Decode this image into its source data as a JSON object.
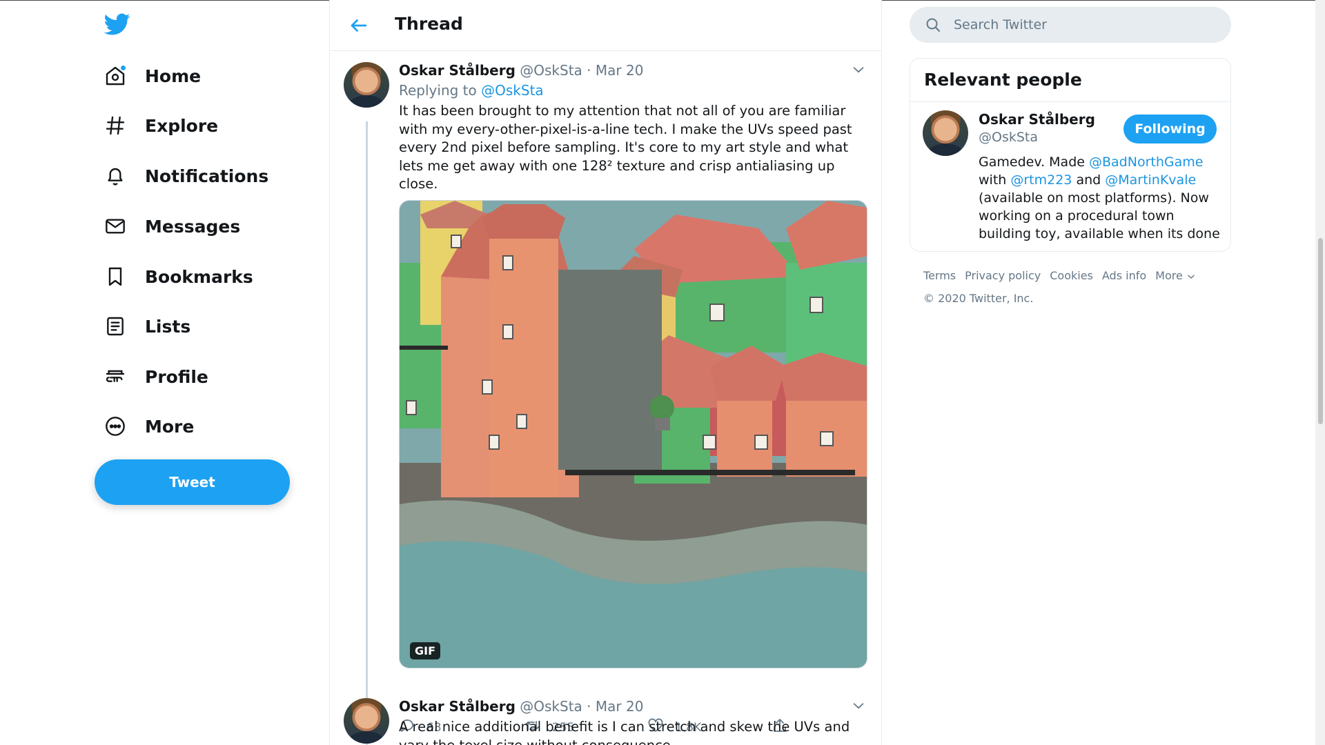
{
  "nav": {
    "items": [
      {
        "label": "Home",
        "icon": "home-icon"
      },
      {
        "label": "Explore",
        "icon": "hashtag-icon"
      },
      {
        "label": "Notifications",
        "icon": "bell-icon"
      },
      {
        "label": "Messages",
        "icon": "envelope-icon"
      },
      {
        "label": "Bookmarks",
        "icon": "bookmark-icon"
      },
      {
        "label": "Lists",
        "icon": "list-icon"
      },
      {
        "label": "Profile",
        "icon": "person-icon"
      },
      {
        "label": "More",
        "icon": "more-circle-icon"
      }
    ],
    "tweet_button": "Tweet"
  },
  "header": {
    "title": "Thread"
  },
  "tweets": [
    {
      "name": "Oskar Stålberg",
      "handle": "@OskSta",
      "separator": "·",
      "date": "Mar 20",
      "replying_prefix": "Replying to",
      "replying_to": "@OskSta",
      "text": "It has been brought to my attention that not all of you are familiar with my every-other-pixel-is-a-line tech. I make the UVs speed past every 2nd pixel before sampling. It's core to my art style and what lets me get away with one 128² texture and crisp antialiasing up close.",
      "media_badge": "GIF",
      "replies": "63",
      "retweets": "255",
      "likes": "1.8K"
    },
    {
      "name": "Oskar Stålberg",
      "handle": "@OskSta",
      "separator": "·",
      "date": "Mar 20",
      "text": "A real nice additional benefit is I can stretch and skew the UVs and vary the texel size without consequence."
    }
  ],
  "search": {
    "placeholder": "Search Twitter"
  },
  "relevant_people": {
    "title": "Relevant people",
    "person": {
      "name": "Oskar Stålberg",
      "handle": "@OskSta",
      "follow_label": "Following",
      "bio_1": "Gamedev. Made ",
      "bio_link_1": "@BadNorthGame",
      "bio_2": " with ",
      "bio_link_2": "@rtm223",
      "bio_3": " and ",
      "bio_link_3": "@MartinKvale",
      "bio_4": " (available on most platforms). Now working on a procedural town building toy, available when its done"
    }
  },
  "footer": {
    "links": [
      "Terms",
      "Privacy policy",
      "Cookies",
      "Ads info",
      "More"
    ],
    "copyright": "© 2020 Twitter, Inc."
  },
  "colors": {
    "accent": "#1da1f2",
    "link": "#1b95e0",
    "muted": "#657786",
    "text": "#14171a"
  }
}
